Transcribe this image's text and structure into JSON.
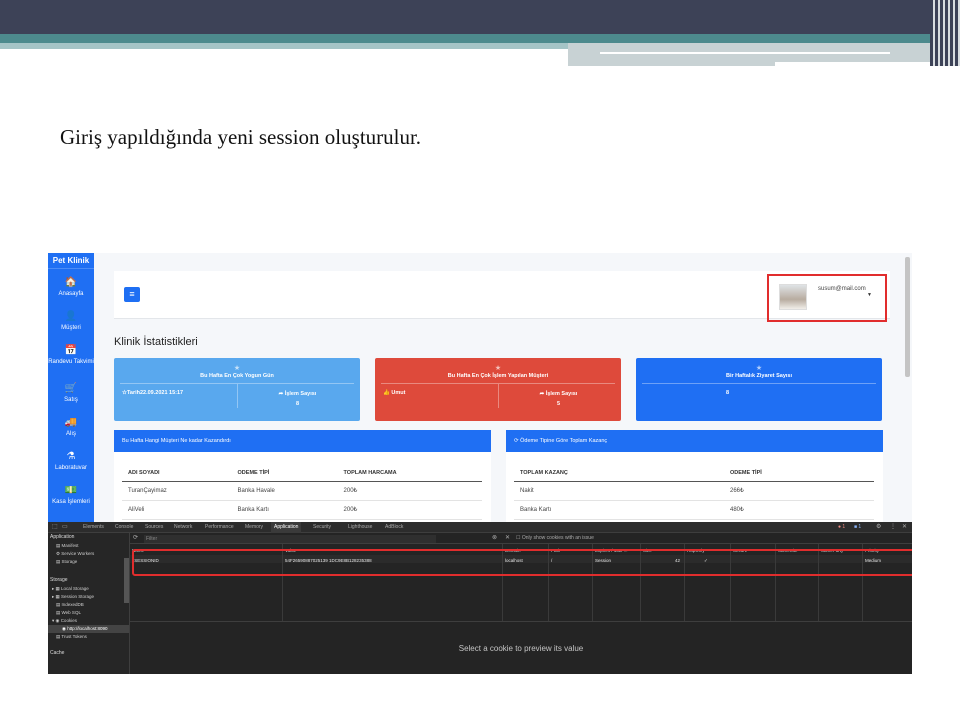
{
  "slide": {
    "title": "Giriş yapıldığında yeni session oluşturulur."
  },
  "app": {
    "brand": "Pet Klinik",
    "nav": [
      {
        "icon": "home-icon",
        "glyph": "🏠",
        "label": "Anasayfa"
      },
      {
        "icon": "user-icon",
        "glyph": "👤",
        "label": "Müşteri"
      },
      {
        "icon": "calendar-icon",
        "glyph": "📅",
        "label": "Randevu Takvimi"
      },
      {
        "icon": "cart-icon",
        "glyph": "🛒",
        "label": "Satış"
      },
      {
        "icon": "truck-icon",
        "glyph": "🚚",
        "label": "Alış"
      },
      {
        "icon": "flask-icon",
        "glyph": "⚗",
        "label": "Laboratuvar"
      },
      {
        "icon": "cash-icon",
        "glyph": "💵",
        "label": "Kasa İşlemleri"
      }
    ],
    "user_email": "susum@mail.com",
    "page_title": "Klinik İstatistikleri",
    "cards": [
      {
        "title": "Bu Hafta En Çok Yogun Gün",
        "left": "Tarih22.09.2021 15:17",
        "right_label": "İşlem Sayısı",
        "right_value": "8",
        "color": "#59a8ee"
      },
      {
        "title": "Bu Hafta En Çok İşlem Yapılan Müşteri",
        "left": "Umut",
        "right_label": "İşlem Sayısı",
        "right_value": "5",
        "color": "#de4a3b"
      },
      {
        "title": "Bir Haftalık Ziyaret Sayısı",
        "value": "8",
        "color": "#1f6ff3"
      }
    ],
    "panel_left": {
      "header": "Bu Hafta Hangi Müşteri Ne kadar Kazandırdı",
      "columns": [
        "ADI SOYADI",
        "ODEME TİPİ",
        "TOPLAM HARCAMA"
      ],
      "rows": [
        [
          "TuranÇayimaz",
          "Banka Havale",
          "200₺"
        ],
        [
          "AliVeli",
          "Banka Kartı",
          "200₺"
        ]
      ]
    },
    "panel_right": {
      "header": "Ödeme Tipine Göre Toplam Kazanç",
      "columns": [
        "TOPLAM KAZANÇ",
        "ODEME TİPİ"
      ],
      "rows": [
        [
          "Nakit",
          "266₺"
        ],
        [
          "Banka Kartı",
          "480₺"
        ]
      ]
    }
  },
  "devtools": {
    "tabs": [
      "Elements",
      "Console",
      "Sources",
      "Network",
      "Performance",
      "Memory",
      "Application",
      "Security",
      "Lighthouse",
      "AdBlock"
    ],
    "active_tab": "Application",
    "errors": "1",
    "info": "1",
    "filter_placeholder": "Filter",
    "only_issues_label": "Only show cookies with an issue",
    "sidebar": {
      "application_header": "Application",
      "application_items": [
        "Manifest",
        "Service Workers",
        "Storage"
      ],
      "storage_header": "Storage",
      "storage_items": [
        "Local Storage",
        "Session Storage",
        "IndexedDB",
        "Web SQL",
        "Cookies",
        "http://localhost:8090",
        "Trust Tokens"
      ],
      "cache_header": "Cache"
    },
    "columns": [
      "Name",
      "Value",
      "Domain",
      "Path",
      "Expires / Max-...",
      "Size",
      "HttpOnly",
      "Secure",
      "SameSite",
      "SameParty",
      "Priority"
    ],
    "cookie": {
      "name": "JSESSIONID",
      "value": "54F26590887025139 1DC9E8B128235388",
      "domain": "localhost",
      "path": "/",
      "expires": "Session",
      "size": "42",
      "httponly": "✓",
      "priority": "Medium"
    },
    "preview_text": "Select a cookie to preview its value"
  }
}
